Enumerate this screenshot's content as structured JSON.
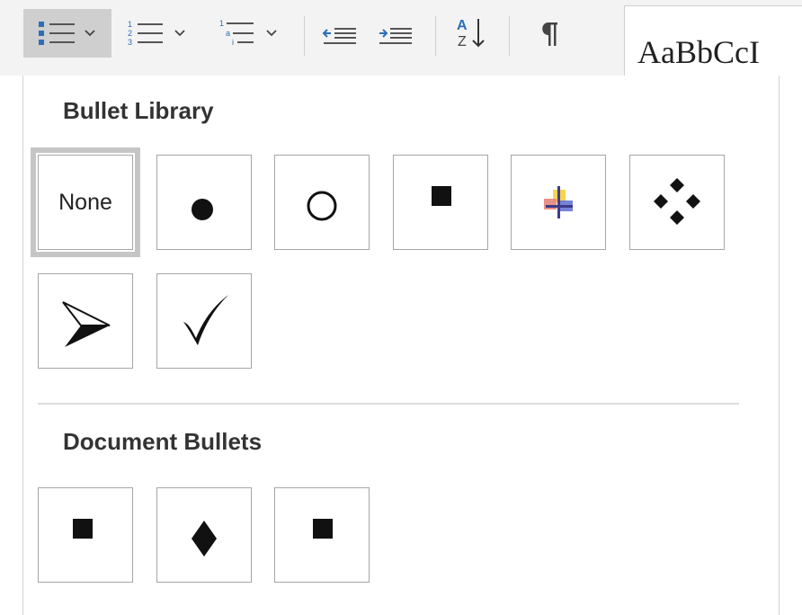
{
  "toolbar": {
    "buttons": [
      {
        "name": "bullets",
        "icon": "bullet-list-icon",
        "has_dropdown": true,
        "active": true
      },
      {
        "name": "numbering",
        "icon": "numbered-list-icon",
        "has_dropdown": true
      },
      {
        "name": "multilevel-list",
        "icon": "multilevel-list-icon",
        "has_dropdown": true
      },
      {
        "name": "decrease-indent",
        "icon": "decrease-indent-icon"
      },
      {
        "name": "increase-indent",
        "icon": "increase-indent-icon"
      },
      {
        "name": "sort",
        "icon": "sort-az-icon"
      },
      {
        "name": "show-hide",
        "icon": "pilcrow-icon"
      }
    ],
    "styles_preview_text": "AaBbCcI"
  },
  "bullet_library": {
    "title": "Bullet Library",
    "items": [
      {
        "label": "None",
        "icon": "none"
      },
      {
        "icon": "filled-circle-bullet-icon"
      },
      {
        "icon": "hollow-circle-bullet-icon"
      },
      {
        "icon": "filled-square-bullet-icon"
      },
      {
        "icon": "multicolor-cross-bullet-icon"
      },
      {
        "icon": "four-diamond-bullet-icon"
      },
      {
        "icon": "arrowhead-bullet-icon"
      },
      {
        "icon": "checkmark-bullet-icon"
      }
    ]
  },
  "document_bullets": {
    "title": "Document Bullets",
    "items": [
      {
        "icon": "square-bullet-icon"
      },
      {
        "icon": "diamond-bullet-icon"
      },
      {
        "icon": "square-bullet-icon"
      }
    ]
  },
  "colors": {
    "ribbon_bg": "#f3f3f3",
    "icon_blue": "#2b6fb6",
    "active_button_bg": "#cfcfcf",
    "cell_border": "#a6a6a6",
    "selected_outline": "#c5c5c5"
  }
}
